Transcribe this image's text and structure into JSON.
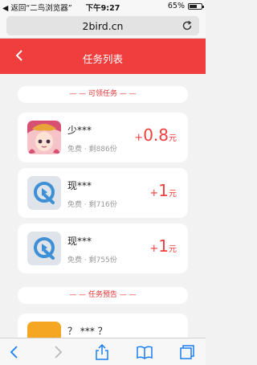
{
  "status_bar": {
    "back_label": "◀ 返回“二鸟浏览器”",
    "time": "下午9:27",
    "battery_percent": "65%",
    "battery_level": 0.65
  },
  "browser": {
    "url": "2bird.cn"
  },
  "header": {
    "title": "任务列表"
  },
  "sections": {
    "available_label": "— — 可领任务 — —",
    "preview_label": "— — 任务预告 — —"
  },
  "tasks": [
    {
      "name": "少***",
      "plus": "+",
      "amount": "0.8",
      "unit": "元",
      "free_label": "免费",
      "remaining": "剩886份",
      "icon": "game-character-icon"
    },
    {
      "name": "现***",
      "plus": "+",
      "amount": "1",
      "unit": "元",
      "free_label": "免费",
      "remaining": "剩716份",
      "icon": "q-logo-icon"
    },
    {
      "name": "现***",
      "plus": "+",
      "amount": "1",
      "unit": "元",
      "free_label": "免费",
      "remaining": "剩755份",
      "icon": "q-logo-icon"
    }
  ],
  "preview_tasks": [
    {
      "name": "？ *** ？",
      "icon": "orange-app-icon"
    }
  ],
  "colors": {
    "accent": "#f03d3d",
    "ios_blue": "#1a7ef2"
  }
}
